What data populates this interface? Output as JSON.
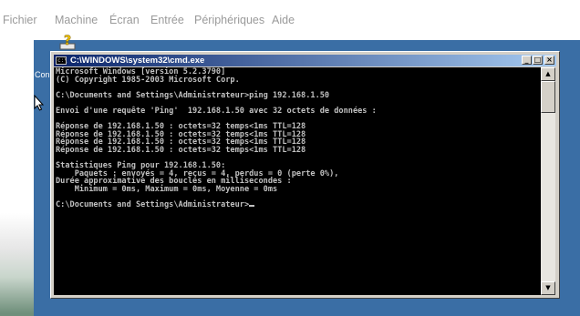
{
  "menubar": {
    "items": [
      "Fichier",
      "Machine",
      "Écran",
      "Entrée",
      "Périphériques",
      "Aide"
    ]
  },
  "desktop": {
    "label": "Con"
  },
  "window": {
    "title": "C:\\WINDOWS\\system32\\cmd.exe",
    "icon_text": "c:\\",
    "controls": {
      "minimize": "_",
      "maximize": "□",
      "close": "×"
    }
  },
  "console": {
    "lines": [
      "Microsoft Windows [version 5.2.3790]",
      "(C) Copyright 1985-2003 Microsoft Corp.",
      "",
      "C:\\Documents and Settings\\Administrateur>ping 192.168.1.50",
      "",
      "Envoi d'une requête 'Ping'  192.168.1.50 avec 32 octets de données :",
      "",
      "Réponse de 192.168.1.50 : octets=32 temps<1ms TTL=128",
      "Réponse de 192.168.1.50 : octets=32 temps<1ms TTL=128",
      "Réponse de 192.168.1.50 : octets=32 temps<1ms TTL=128",
      "Réponse de 192.168.1.50 : octets=32 temps<1ms TTL=128",
      "",
      "Statistiques Ping pour 192.168.1.50:",
      "    Paquets : envoyés = 4, reçus = 4, perdus = 0 (perte 0%),",
      "Durée approximative des boucles en millisecondes :",
      "    Minimum = 0ms, Maximum = 0ms, Moyenne = 0ms",
      ""
    ],
    "prompt": "C:\\Documents and Settings\\Administrateur>"
  },
  "scrollbar": {
    "up": "▲",
    "down": "▼"
  },
  "colors": {
    "guest_desktop": "#3a6ea5",
    "console_bg": "#000000",
    "console_fg": "#c0c0c0",
    "titlebar_start": "#0a246a",
    "titlebar_end": "#a6caf0"
  }
}
